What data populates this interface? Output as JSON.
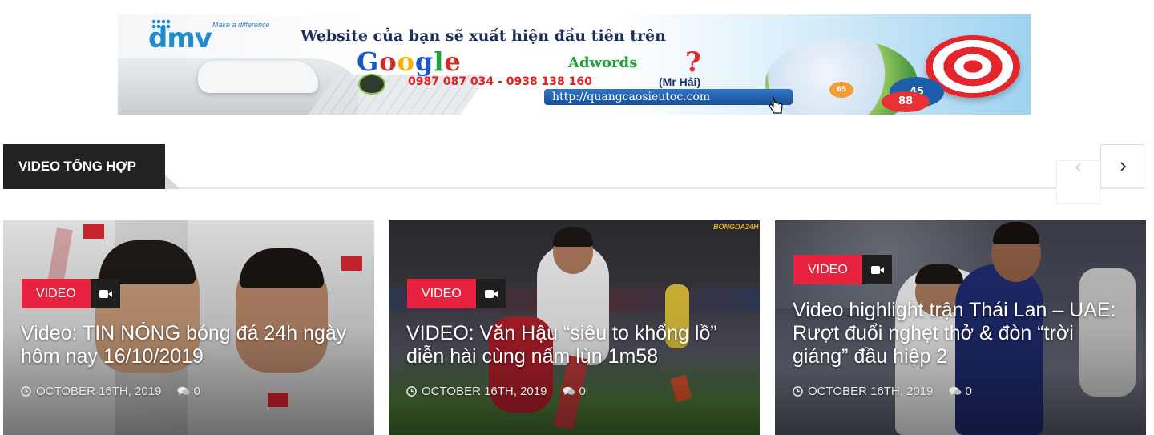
{
  "banner": {
    "brand": "dmv",
    "tagline": "Make a difference",
    "headline": "Website của bạn sẽ xuất hiện đầu tiên trên",
    "google_letters": [
      "G",
      "o",
      "o",
      "g",
      "l",
      "e"
    ],
    "adwords": "Adwords",
    "question": "?",
    "phone": "0987 087 034 - 0938 138 160",
    "contact_name": "(Mr Hải)",
    "url": "http://quangcaosieutoc.com",
    "stat_small": "65",
    "stat_a": "45",
    "stat_b": "88"
  },
  "section": {
    "title": "VIDEO TỔNG HỢP"
  },
  "cards": [
    {
      "category": "VIDEO",
      "title": "Video: TIN NÓNG bóng đá 24h ngày hôm nay 16/10/2019",
      "date": "OCTOBER 16TH, 2019",
      "comments": "0"
    },
    {
      "category": "VIDEO",
      "title": "VIDEO: Văn Hậu “siêu to khổng lồ” diễn hài cùng nấm lùn 1m58",
      "date": "OCTOBER 16TH, 2019",
      "comments": "0",
      "watermark": "BONGDA24H"
    },
    {
      "category": "VIDEO",
      "title": "Video highlight trận Thái Lan – UAE: Rượt đuổi nghẹt thở & đòn “trời giáng” đầu hiệp 2",
      "date": "OCTOBER 16TH, 2019",
      "comments": "0"
    }
  ],
  "colors": {
    "accent": "#e8233f",
    "header_bg": "#222222"
  },
  "icons": {
    "prev": "chevron-left-icon",
    "next": "chevron-right-icon",
    "category": "video-camera-icon",
    "date": "clock-icon",
    "comments": "comments-icon"
  }
}
